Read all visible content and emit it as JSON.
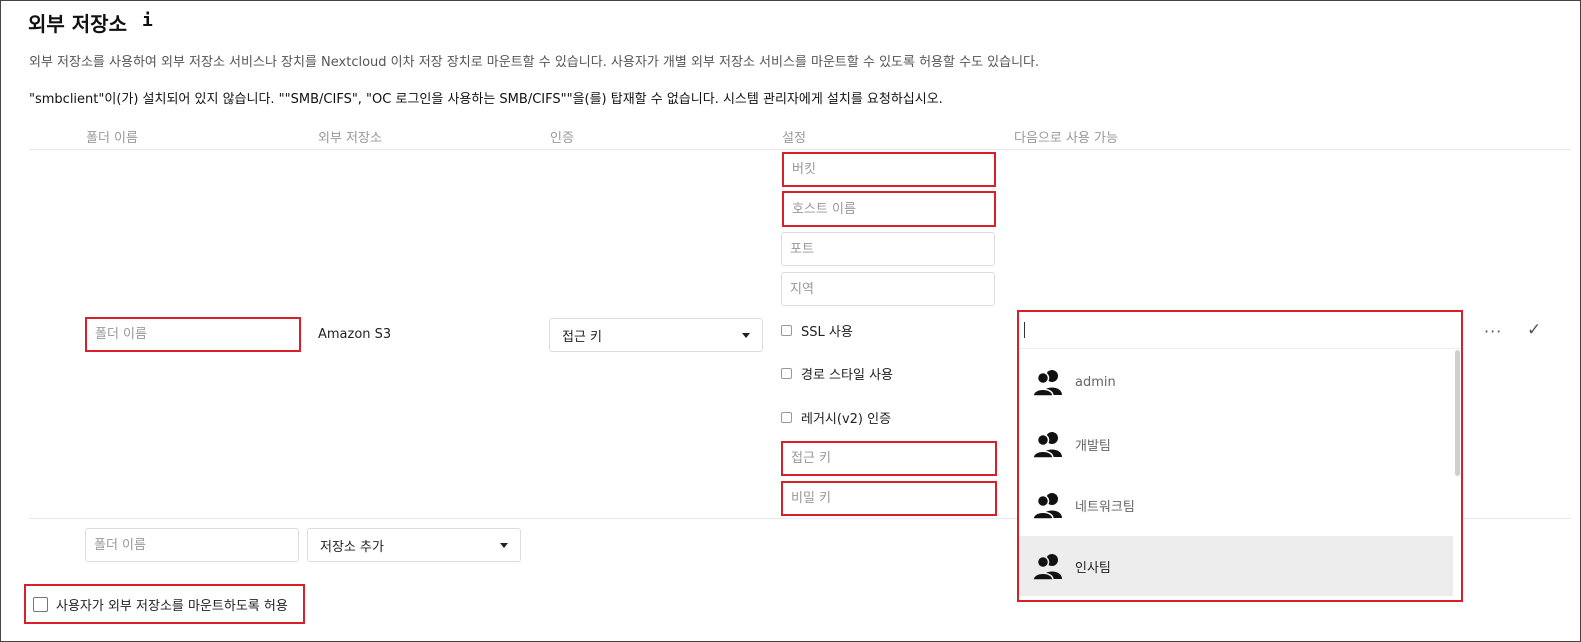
{
  "header": {
    "title": "외부 저장소",
    "info_icon": "i",
    "description": "외부 저장소를 사용하여 외부 저장소 서비스나 장치를 Nextcloud 이차 저장 장치로 마운트할 수 있습니다. 사용자가 개별 외부 저장소 서비스를 마운트할 수 있도록 허용할 수도 있습니다.",
    "warning": "\"smbclient\"이(가) 설치되어 있지 않습니다. \"\"SMB/CIFS\", \"OC 로그인을 사용하는 SMB/CIFS\"\"을(를) 탑재할 수 없습니다. 시스템 관리자에게 설치를 요청하십시오."
  },
  "table": {
    "columns": [
      "폴더 이름",
      "외부 저장소",
      "인증",
      "설정",
      "다음으로 사용 가능"
    ]
  },
  "mount_row": {
    "folder_placeholder": "폴더 이름",
    "backend": "Amazon S3",
    "auth_selected": "접근 키",
    "config": {
      "bucket_placeholder": "버킷",
      "hostname_placeholder": "호스트 이름",
      "port_placeholder": "포트",
      "region_placeholder": "지역",
      "ssl_label": "SSL 사용",
      "path_style_label": "경로 스타일 사용",
      "legacy_auth_label": "레거시(v2) 인증",
      "access_key_placeholder": "접근 키",
      "secret_key_placeholder": "비밀 키"
    },
    "applicable": {
      "options": [
        {
          "label": "admin",
          "icon": "group-icon"
        },
        {
          "label": "개발팀",
          "icon": "group-icon"
        },
        {
          "label": "네트워크팀",
          "icon": "group-icon"
        },
        {
          "label": "인사팀",
          "icon": "group-icon",
          "highlighted": true
        }
      ]
    },
    "more_icon": "···",
    "save_icon": "✓"
  },
  "new_row": {
    "folder_placeholder": "폴더 이름",
    "add_storage_label": "저장소 추가"
  },
  "allow_user_mounting": {
    "label": "사용자가 외부 저장소를 마운트하도록 허용"
  },
  "colors": {
    "highlight": "#d8202a",
    "muted_text": "#999999",
    "selected_option_bg": "#ededed"
  }
}
